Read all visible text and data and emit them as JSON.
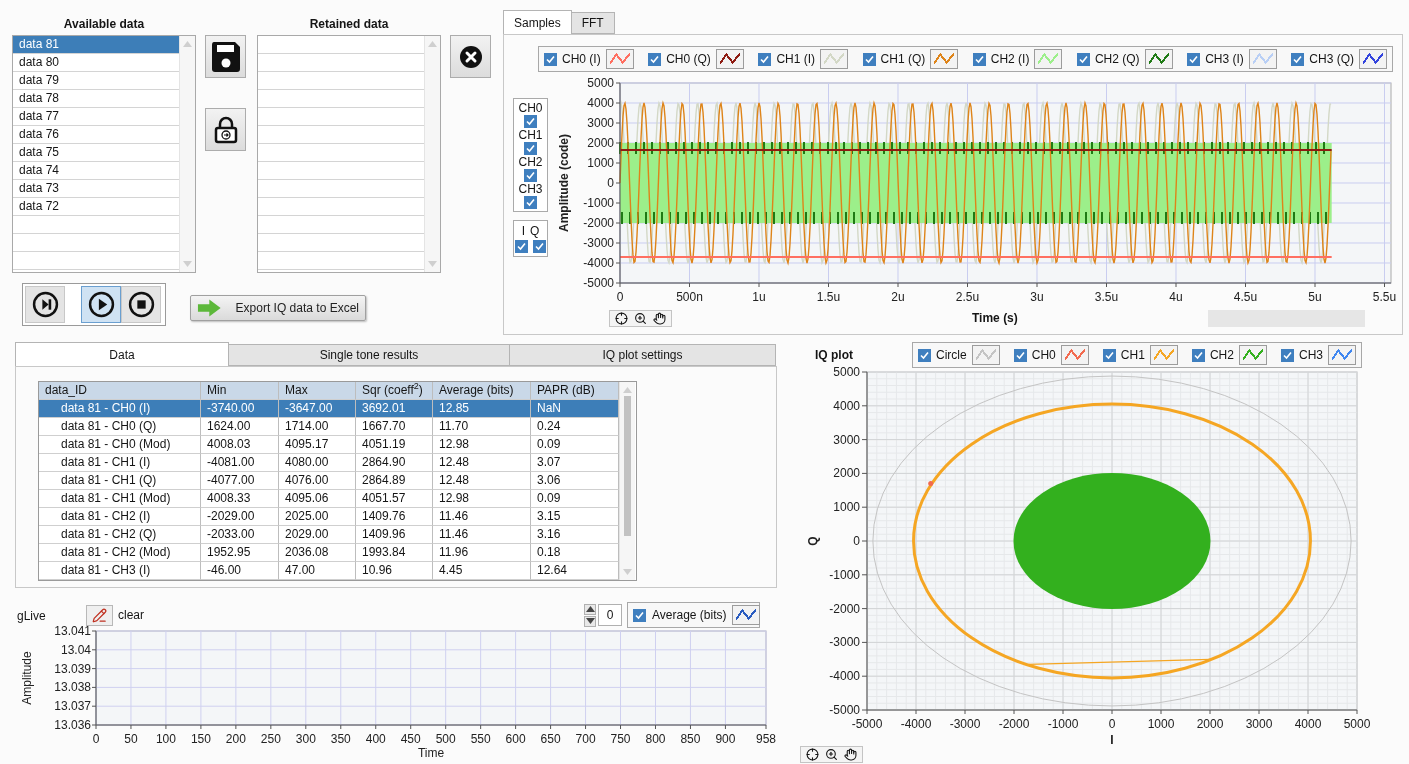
{
  "available": {
    "title": "Available data",
    "items": [
      {
        "label": "data 81",
        "selected": true
      },
      {
        "label": "data 80",
        "selected": false
      },
      {
        "label": "data 79",
        "selected": false
      },
      {
        "label": "data 78",
        "selected": false
      },
      {
        "label": "data 77",
        "selected": false
      },
      {
        "label": "data 76",
        "selected": false
      },
      {
        "label": "data 75",
        "selected": false
      },
      {
        "label": "data 74",
        "selected": false
      },
      {
        "label": "data 73",
        "selected": false
      },
      {
        "label": "data 72",
        "selected": false
      }
    ]
  },
  "retained": {
    "title": "Retained data"
  },
  "transport": [
    {
      "kind": "step",
      "selected": false
    },
    {
      "kind": "play",
      "selected": true
    },
    {
      "kind": "stop",
      "selected": false
    }
  ],
  "export_button": "Export IQ data to Excel",
  "samples_panel": {
    "tabs": [
      {
        "label": "Samples",
        "selected": true
      },
      {
        "label": "FFT",
        "selected": false
      }
    ],
    "legend": [
      {
        "label": "CH0 (I)",
        "checked": true,
        "color": "#ff6f61"
      },
      {
        "label": "CH0 (Q)",
        "checked": true,
        "color": "#8e1b12"
      },
      {
        "label": "CH1 (I)",
        "checked": true,
        "color": "#d3d8c6"
      },
      {
        "label": "CH1 (Q)",
        "checked": true,
        "color": "#de8419"
      },
      {
        "label": "CH2 (I)",
        "checked": true,
        "color": "#9cef8a"
      },
      {
        "label": "CH2 (Q)",
        "checked": true,
        "color": "#1f7a14"
      },
      {
        "label": "CH3 (I)",
        "checked": true,
        "color": "#b9cff5"
      },
      {
        "label": "CH3 (Q)",
        "checked": true,
        "color": "#3344dd"
      }
    ],
    "channel_toggles": [
      {
        "label": "CH0",
        "checked": true
      },
      {
        "label": "CH1",
        "checked": true
      },
      {
        "label": "CH2",
        "checked": true
      },
      {
        "label": "CH3",
        "checked": true
      }
    ],
    "iq_toggles": [
      {
        "label": "I",
        "checked": true
      },
      {
        "label": "Q",
        "checked": true
      }
    ],
    "ylabel": "Amplitude (code)",
    "xlabel": "Time (s)",
    "yticks": [
      "5000",
      "4000",
      "3000",
      "2000",
      "1000",
      "0",
      "-1000",
      "-2000",
      "-3000",
      "-4000",
      "-5000"
    ],
    "xticks": [
      "0",
      "500n",
      "1u",
      "1.5u",
      "2u",
      "2.5u",
      "3u",
      "3.5u",
      "4u",
      "4.5u",
      "5u",
      "5.5u"
    ]
  },
  "data_panel": {
    "tabs": [
      {
        "label": "Data",
        "selected": true
      },
      {
        "label": "Single tone results",
        "selected": false
      },
      {
        "label": "IQ plot settings",
        "selected": false
      }
    ],
    "columns": [
      "data_ID",
      "Min",
      "Max",
      "Sqr (coeff$^{2}$)",
      "Average (bits)",
      "PAPR (dB)"
    ],
    "rows": [
      {
        "cells": [
          "data 81 - CH0 (I)",
          "-3740.00",
          "-3647.00",
          "3692.01",
          "12.85",
          "NaN"
        ],
        "selected": true
      },
      {
        "cells": [
          "data 81 - CH0 (Q)",
          "1624.00",
          "1714.00",
          "1667.70",
          "11.70",
          "0.24"
        ],
        "selected": false
      },
      {
        "cells": [
          "data 81 - CH0 (Mod)",
          "4008.03",
          "4095.17",
          "4051.19",
          "12.98",
          "0.09"
        ],
        "selected": false
      },
      {
        "cells": [
          "data 81 - CH1 (I)",
          "-4081.00",
          "4080.00",
          "2864.90",
          "12.48",
          "3.07"
        ],
        "selected": false
      },
      {
        "cells": [
          "data 81 - CH1 (Q)",
          "-4077.00",
          "4076.00",
          "2864.89",
          "12.48",
          "3.06"
        ],
        "selected": false
      },
      {
        "cells": [
          "data 81 - CH1 (Mod)",
          "4008.33",
          "4095.06",
          "4051.57",
          "12.98",
          "0.09"
        ],
        "selected": false
      },
      {
        "cells": [
          "data 81 - CH2 (I)",
          "-2029.00",
          "2025.00",
          "1409.76",
          "11.46",
          "3.15"
        ],
        "selected": false
      },
      {
        "cells": [
          "data 81 - CH2 (Q)",
          "-2033.00",
          "2029.00",
          "1409.96",
          "11.46",
          "3.16"
        ],
        "selected": false
      },
      {
        "cells": [
          "data 81 - CH2 (Mod)",
          "1952.95",
          "2036.08",
          "1993.84",
          "11.96",
          "0.18"
        ],
        "selected": false
      },
      {
        "cells": [
          "data 81 - CH3 (I)",
          "-46.00",
          "47.00",
          "10.96",
          "4.45",
          "12.64"
        ],
        "selected": false
      }
    ]
  },
  "live_chart": {
    "title": "gLive",
    "clear_label": "clear",
    "counter": "0",
    "legend": {
      "label": "Average (bits)",
      "checked": true,
      "color": "#2a5cc0"
    },
    "ylabel": "Amplitude",
    "xlabel": "Time",
    "yticks": [
      "13.041",
      "13.04",
      "13.039",
      "13.038",
      "13.037",
      "13.036"
    ],
    "xticks": [
      "0",
      "50",
      "100",
      "150",
      "200",
      "250",
      "300",
      "350",
      "400",
      "450",
      "500",
      "550",
      "600",
      "650",
      "700",
      "750",
      "800",
      "850",
      "900",
      "958"
    ]
  },
  "iq_plot": {
    "title": "IQ plot",
    "legend": [
      {
        "label": "Circle",
        "checked": true,
        "color": "#c4c4c4"
      },
      {
        "label": "CH0",
        "checked": true,
        "color": "#f26a4f"
      },
      {
        "label": "CH1",
        "checked": true,
        "color": "#f5a623"
      },
      {
        "label": "CH2",
        "checked": true,
        "color": "#33b01e"
      },
      {
        "label": "CH3",
        "checked": true,
        "color": "#3f86f0"
      }
    ],
    "xlabel": "I",
    "ylabel": "Q",
    "xticks": [
      "-5000",
      "-4000",
      "-3000",
      "-2000",
      "-1000",
      "0",
      "1000",
      "2000",
      "3000",
      "4000",
      "5000"
    ],
    "yticks": [
      "5000",
      "4000",
      "3000",
      "2000",
      "1000",
      "0",
      "-1000",
      "-2000",
      "-3000",
      "-4000",
      "-5000"
    ]
  }
}
